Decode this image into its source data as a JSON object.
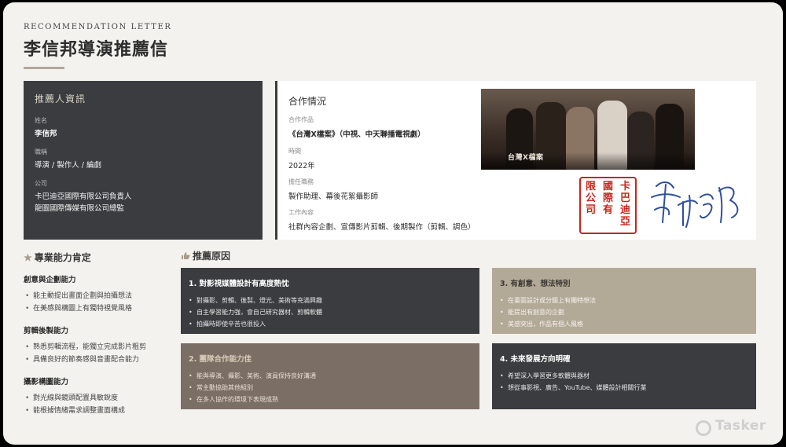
{
  "header": {
    "eyebrow": "RECOMMENDATION LETTER",
    "title": "李信邦導演推薦信"
  },
  "recommender": {
    "heading": "推薦人資訊",
    "name_label": "姓名",
    "name": "李信邦",
    "position_label": "職稱",
    "position": "導演 / 製作人 / 編劇",
    "company_label": "公司",
    "company_lines": [
      "卡巴迪亞國際有限公司負責人",
      "龍圖國際傳媒有限公司總監"
    ]
  },
  "collaboration": {
    "heading": "合作情況",
    "work_label": "合作作品",
    "work": "《台灣X檔案》（中視、中天聯播電視劇）",
    "time_label": "時間",
    "time": "2022年",
    "role_label": "擔任職務",
    "role": "製作助理、幕後花絮攝影師",
    "content_label": "工作內容",
    "content": "社群內容企劃、宣傳影片剪輯、後期製作（剪輯、調色）",
    "poster_logo": "台灣X檔案",
    "seal_chars": [
      "卡",
      "巴",
      "迪",
      "亞",
      "國",
      "際",
      "有",
      "限",
      "公",
      "司"
    ],
    "signature_text": "李信邦"
  },
  "skills": {
    "title": "專業能力肯定",
    "groups": [
      {
        "name": "創意與企劃能力",
        "items": [
          "能主動提出畫面企劃與拍攝想法",
          "在美感與構圖上有獨特視覺風格"
        ]
      },
      {
        "name": "剪輯後製能力",
        "items": [
          "熟悉剪輯流程，能獨立完成影片粗剪",
          "具備良好的節奏感與音畫配合能力"
        ]
      },
      {
        "name": "攝影構圖能力",
        "items": [
          "對光線與鏡頭配置具敏銳度",
          "能根據情緒需求調整畫面構成"
        ]
      }
    ]
  },
  "reasons": {
    "title": "推薦原因",
    "cards": [
      {
        "title": "1. 對影視媒體設計有高度熱忱",
        "items": [
          "對攝影、剪輯、後製、燈光、美術等充滿興趣",
          "自主學習能力強，會自己研究器材、剪輯軟體",
          "拍攝時即使辛苦也很投入"
        ]
      },
      {
        "title": "2. 團隊合作能力佳",
        "items": [
          "能與導演、攝影、美術、演員保持良好溝通",
          "常主動協助其他組別",
          "在多人協作的環境下表現成熟"
        ]
      },
      {
        "title": "3. 有創意、想法特別",
        "items": [
          "在畫面設計或分鏡上有獨特想法",
          "能提出有創意的企劃",
          "美感突出，作品有個人風格"
        ]
      },
      {
        "title": "4. 未來發展方向明確",
        "items": [
          "希望深入學習更多軟體與器材",
          "想從事影視、廣告、YouTube、媒體設計相關行業"
        ]
      }
    ]
  },
  "watermark": "Tasker",
  "colors": {
    "dark": "#3a3c3f",
    "taupe": "#7b6f65",
    "sand": "#b3a997",
    "seal_red": "#c8261e",
    "signature_blue": "#2f4f9e"
  }
}
